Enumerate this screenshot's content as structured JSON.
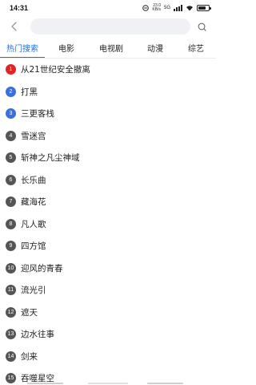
{
  "status_bar": {
    "time": "14:31",
    "net_speed_top": "23.0",
    "net_speed_bottom": "KB/s",
    "network": "5G",
    "battery_level": 0.75
  },
  "search": {
    "placeholder": ""
  },
  "tabs": [
    {
      "label": "热门搜索"
    },
    {
      "label": "电影"
    },
    {
      "label": "电视剧"
    },
    {
      "label": "动漫"
    },
    {
      "label": "综艺"
    }
  ],
  "colors": {
    "accent": "#1f6fe0",
    "rank_1": "#e32222",
    "rank_top": "#3a6fe0",
    "rank_other": "#555555"
  },
  "hot_list": [
    {
      "rank": "1",
      "title": "从21世纪安全撤离"
    },
    {
      "rank": "2",
      "title": "打黑"
    },
    {
      "rank": "3",
      "title": "三更客栈"
    },
    {
      "rank": "4",
      "title": "雪迷宫"
    },
    {
      "rank": "5",
      "title": "斩神之凡尘神域"
    },
    {
      "rank": "6",
      "title": "长乐曲"
    },
    {
      "rank": "7",
      "title": "藏海花"
    },
    {
      "rank": "8",
      "title": "凡人歌"
    },
    {
      "rank": "9",
      "title": "四方馆"
    },
    {
      "rank": "10",
      "title": "迎风的青春"
    },
    {
      "rank": "11",
      "title": "流光引"
    },
    {
      "rank": "12",
      "title": "遮天"
    },
    {
      "rank": "13",
      "title": "边水往事"
    },
    {
      "rank": "14",
      "title": "剑来"
    },
    {
      "rank": "15",
      "title": "吞噬星空"
    }
  ],
  "icons": {
    "back": "chevron-left-icon",
    "search": "search-icon"
  }
}
